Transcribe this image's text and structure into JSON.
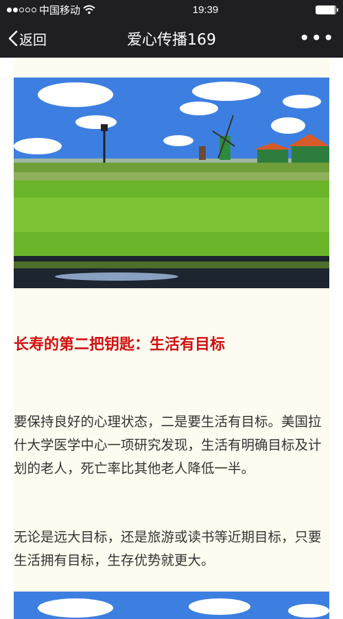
{
  "status_bar": {
    "carrier": "中国移动",
    "time": "19:39",
    "signal_full": 2,
    "signal_total": 5,
    "battery_level": 0.95
  },
  "nav": {
    "back_label": "返回",
    "title": "爱心传播169",
    "more_label": "•••"
  },
  "article": {
    "heading": "长寿的第二把钥匙：生活有目标",
    "paragraphs": [
      "要保持良好的心理状态，二是要生活有目标。美国拉什大学医学中心一项研究发现，生活有明确目标及计划的老人，死亡率比其他老人降低一半。",
      "无论是远大目标，还是旅游或读书等近期目标，只要生活拥有目标，生存优势就更大。"
    ],
    "heading_color": "#d01010"
  }
}
